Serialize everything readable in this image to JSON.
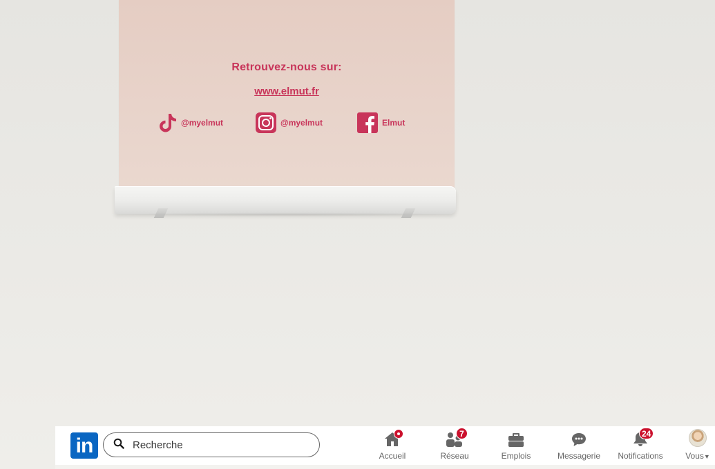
{
  "banner": {
    "heading": "Retrouvez-nous sur:",
    "url": "www.elmut.fr",
    "socials": [
      {
        "icon": "tiktok-icon",
        "handle": "@myelmut"
      },
      {
        "icon": "instagram-icon",
        "handle": "@myelmut"
      },
      {
        "icon": "facebook-icon",
        "handle": "Elmut"
      }
    ],
    "accent_color": "#c8355a"
  },
  "nav": {
    "logo": "in",
    "search": {
      "placeholder": "Recherche",
      "value": ""
    },
    "items": [
      {
        "icon": "home-icon",
        "label": "Accueil",
        "badge": ""
      },
      {
        "icon": "network-icon",
        "label": "Réseau",
        "badge": "7"
      },
      {
        "icon": "briefcase-icon",
        "label": "Emplois",
        "badge": ""
      },
      {
        "icon": "messaging-icon",
        "label": "Messagerie",
        "badge": ""
      },
      {
        "icon": "bell-icon",
        "label": "Notifications",
        "badge": "24"
      },
      {
        "icon": "avatar",
        "label": "Vous",
        "badge": ""
      }
    ],
    "brand_color": "#0a66c2",
    "badge_color": "#cb112d"
  }
}
